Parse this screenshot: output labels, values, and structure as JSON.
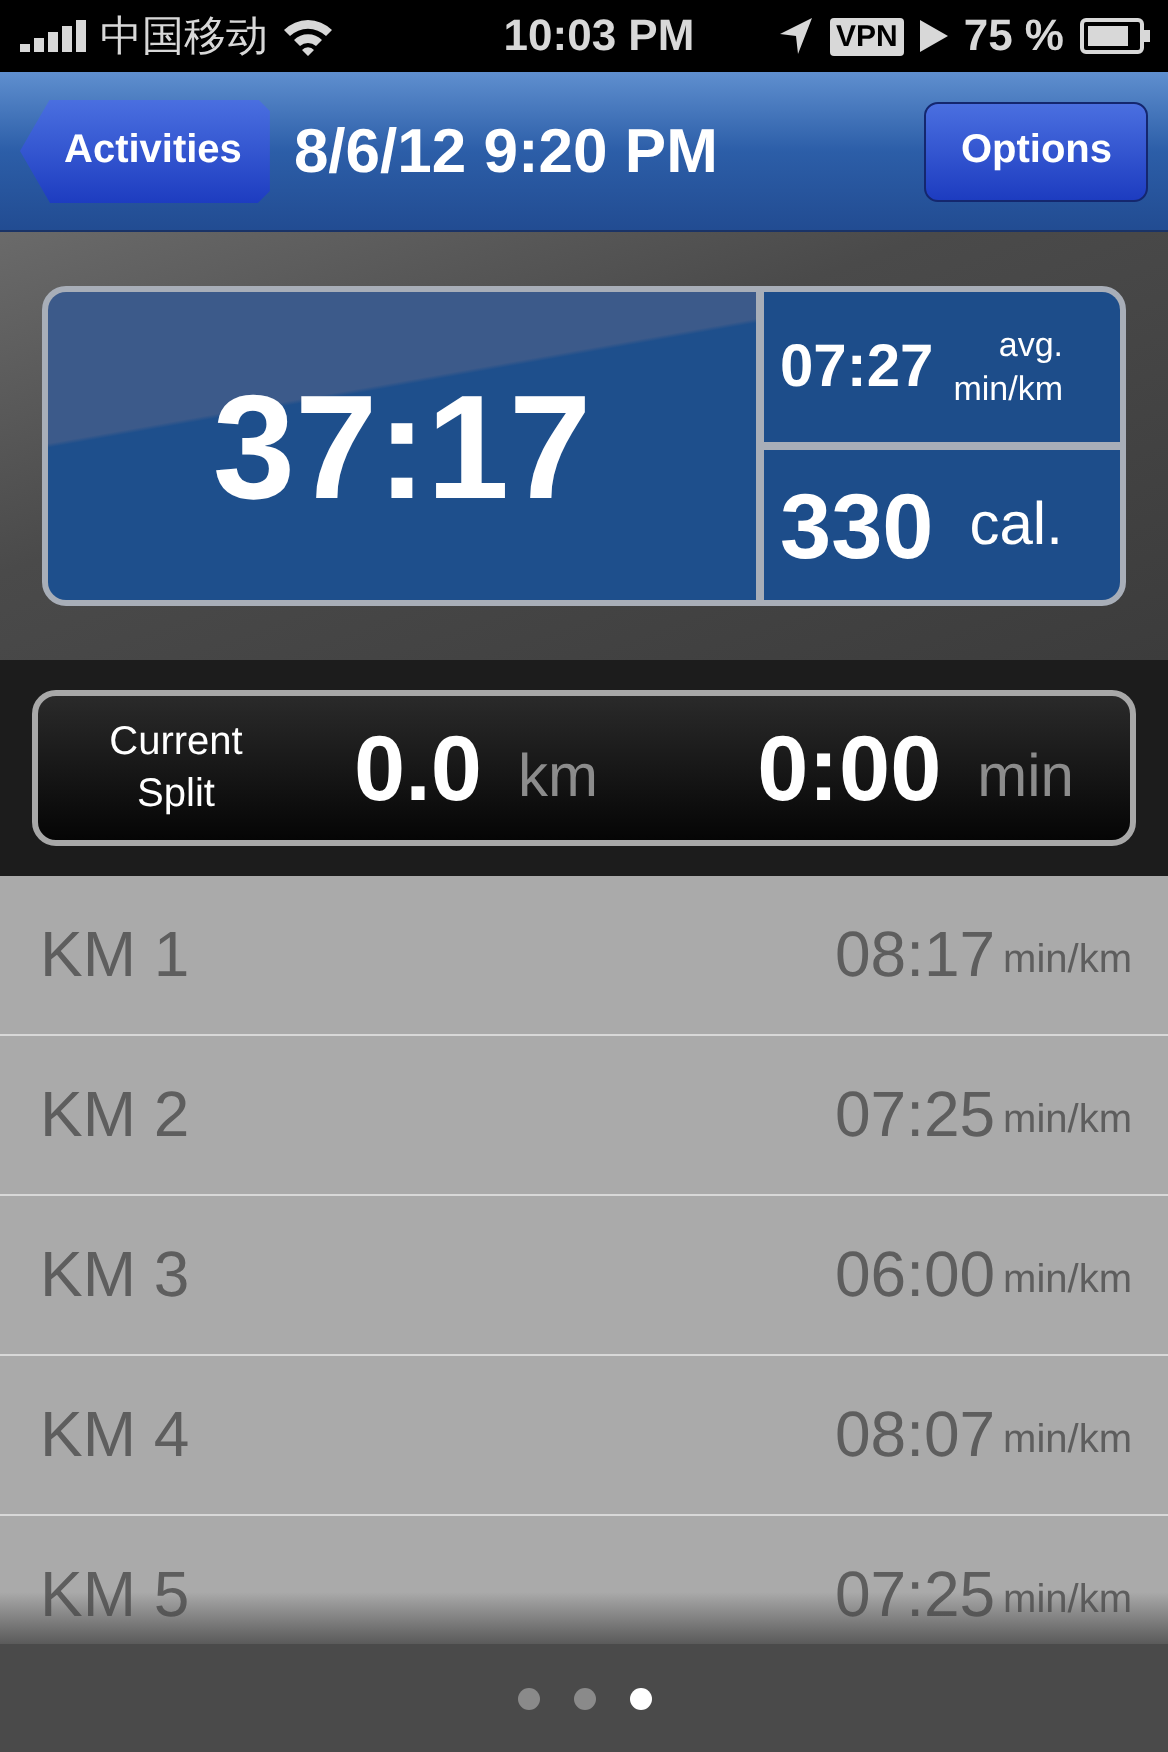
{
  "status_bar": {
    "carrier": "中国移动",
    "time": "10:03 PM",
    "vpn": "VPN",
    "battery_percent": "75 %"
  },
  "nav_bar": {
    "back_button": "Activities",
    "title": "8/6/12 9:20 PM",
    "right_button": "Options"
  },
  "summary": {
    "duration": "37:17",
    "pace": {
      "value": "07:27",
      "label_top": "avg.",
      "label_bottom": "min/km"
    },
    "calories": {
      "value": "330",
      "label": "cal."
    }
  },
  "current_split": {
    "label_top": "Current",
    "label_bottom": "Split",
    "distance": "0.0",
    "distance_unit": "km",
    "time": "0:00",
    "time_unit": "min"
  },
  "splits": [
    {
      "label": "KM 1",
      "pace": "08:17",
      "unit": "min/km"
    },
    {
      "label": "KM 2",
      "pace": "07:25",
      "unit": "min/km"
    },
    {
      "label": "KM 3",
      "pace": "06:00",
      "unit": "min/km"
    },
    {
      "label": "KM 4",
      "pace": "08:07",
      "unit": "min/km"
    },
    {
      "label": "KM 5",
      "pace": "07:25",
      "unit": "min/km"
    }
  ],
  "page_dots": [
    {
      "selected": false
    },
    {
      "selected": false
    },
    {
      "selected": true
    }
  ]
}
